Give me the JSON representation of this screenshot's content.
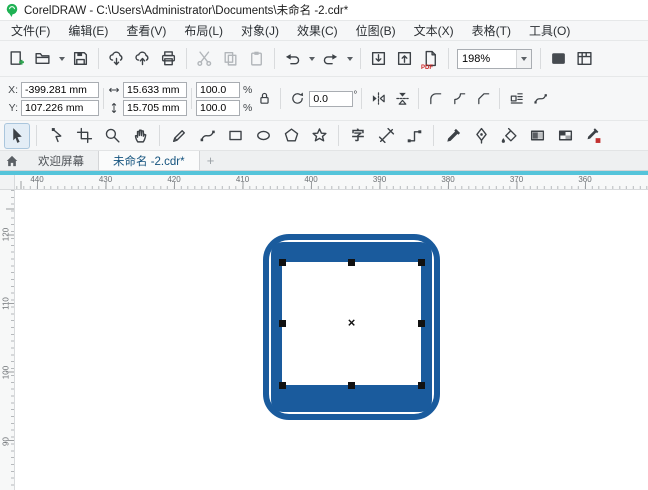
{
  "window": {
    "title": "CorelDRAW - C:\\Users\\Administrator\\Documents\\未命名 -2.cdr*"
  },
  "menubar": {
    "items": [
      {
        "label": "文件(F)"
      },
      {
        "label": "编辑(E)"
      },
      {
        "label": "查看(V)"
      },
      {
        "label": "布局(L)"
      },
      {
        "label": "对象(J)"
      },
      {
        "label": "效果(C)"
      },
      {
        "label": "位图(B)"
      },
      {
        "label": "文本(X)"
      },
      {
        "label": "表格(T)"
      },
      {
        "label": "工具(O)"
      }
    ]
  },
  "toolbar": {
    "zoom_value": "198%",
    "pdf_label": "PDF"
  },
  "propbar": {
    "x_label": "X:",
    "x_value": "-399.281 mm",
    "y_label": "Y:",
    "y_value": "107.226 mm",
    "width_value": "15.633 mm",
    "height_value": "15.705 mm",
    "scale_x": "100.0",
    "scale_y": "100.0",
    "percent": "%",
    "rotation": "0.0",
    "degree": "°"
  },
  "toolbox": {
    "text_tool_glyph": "字"
  },
  "tabbar": {
    "welcome_tab": "欢迎屏幕",
    "document_tab": "未命名 -2.cdr*",
    "add_tab": "+"
  },
  "rulers": {
    "horizontal": [
      "440",
      "430",
      "420",
      "410",
      "400",
      "390",
      "380",
      "370",
      "360"
    ],
    "vertical": [
      "120",
      "110",
      "100",
      "90"
    ]
  },
  "canvas": {
    "center_mark": "×"
  },
  "colors": {
    "artwork_blue": "#1a5b9d",
    "ruler_highlight": "#55c4da",
    "selection_handle": "#111111"
  }
}
